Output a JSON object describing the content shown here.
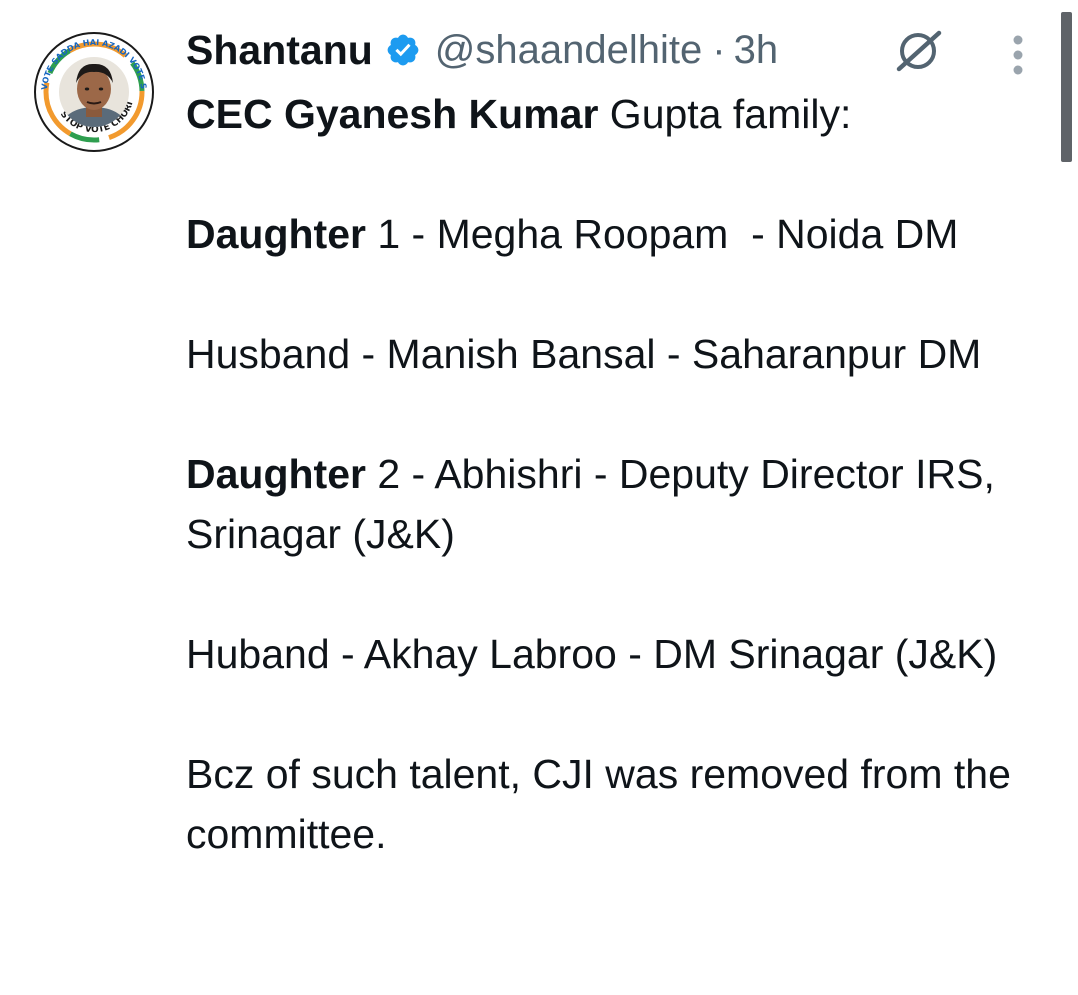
{
  "tweet": {
    "author_name": "Shantanu",
    "handle": "@shaandelhite",
    "separator": "·",
    "time": "3h",
    "verified": true,
    "avatar": {
      "ring_top_text": "VOTE SADDA HAI AZADI VOTE SADDA HAI",
      "ring_bottom_text": "STOP VOTE CHORI"
    },
    "body": {
      "line1_bold": "CEC Gyanesh Kumar",
      "line1_rest": " Gupta family:",
      "p2_bold": "Daughter",
      "p2_rest": " 1 - Megha Roopam  - Noida DM",
      "p3": "Husband - Manish Bansal - Saharanpur DM",
      "p4_bold": "Daughter",
      "p4_rest": " 2 - Abhishri - Deputy Director IRS, Srinagar (J&K)",
      "p5": "Huband - Akhay Labroo - DM Srinagar (J&K)",
      "p6": "Bcz of such talent, CJI was removed from the committee."
    }
  },
  "colors": {
    "text_primary": "#0f1419",
    "text_secondary": "#536471",
    "verified_blue": "#1d9bf0",
    "scrollbar": "#5f6368"
  },
  "icons": {
    "verified": "verified-badge-icon",
    "grok": "grok-icon",
    "more": "more-vertical-icon"
  }
}
